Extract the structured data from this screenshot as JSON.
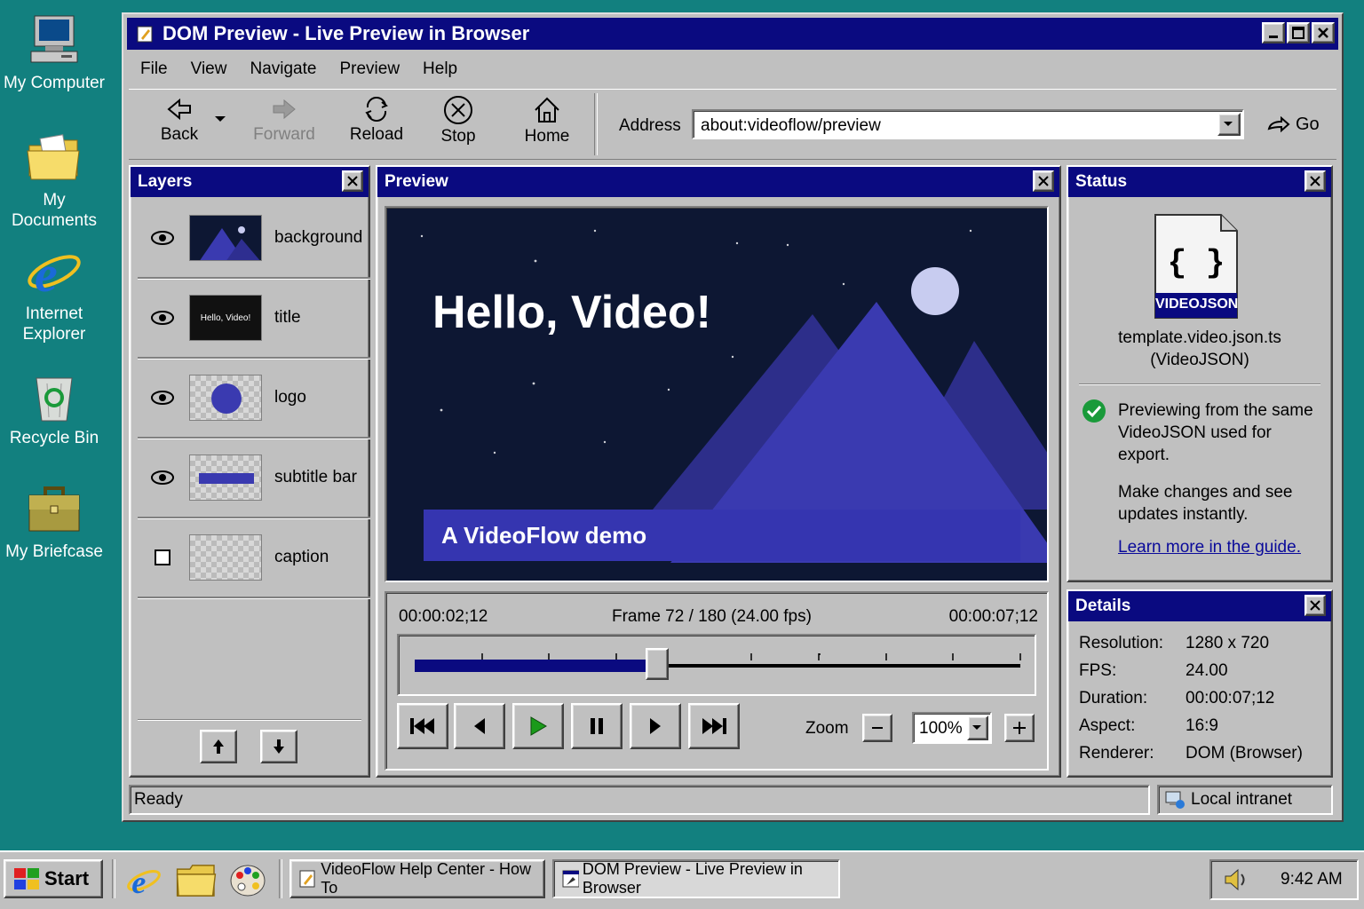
{
  "desktop": {
    "icons": [
      {
        "label": "My Computer",
        "icon": "computer-icon"
      },
      {
        "label": "My Documents",
        "icon": "folder-icon"
      },
      {
        "label": "Internet Explorer",
        "icon": "internet-explorer-icon"
      },
      {
        "label": "Recycle Bin",
        "icon": "recycle-bin-icon"
      },
      {
        "label": "My Briefcase",
        "icon": "briefcase-icon"
      }
    ]
  },
  "window": {
    "title": "DOM Preview - Live Preview in Browser",
    "menu": [
      "File",
      "View",
      "Navigate",
      "Preview",
      "Help"
    ],
    "toolbar": {
      "back": "Back",
      "forward": "Forward",
      "reload": "Reload",
      "stop": "Stop",
      "home": "Home"
    },
    "address": {
      "label": "Address",
      "value": "about:videoflow/preview",
      "go": "Go"
    }
  },
  "layers": {
    "title": "Layers",
    "items": [
      {
        "name": "background",
        "visible": true
      },
      {
        "name": "title",
        "visible": true,
        "thumb_text": "Hello, Video!"
      },
      {
        "name": "logo",
        "visible": true
      },
      {
        "name": "subtitle bar",
        "visible": true
      },
      {
        "name": "caption",
        "visible": false
      }
    ]
  },
  "preview": {
    "title": "Preview",
    "headline": "Hello, Video!",
    "subtitle": "A VideoFlow demo",
    "time_current": "00:00:02;12",
    "frame_info": "Frame 72 / 180 (24.00 fps)",
    "time_total": "00:00:07;12",
    "progress": 0.4,
    "zoom_label": "Zoom",
    "zoom_value": "100%"
  },
  "status": {
    "title": "Status",
    "file_badge": "VIDEOJSON",
    "file_name": "template.video.json.ts",
    "file_type": "(VideoJSON)",
    "message1": "Previewing from the same VideoJSON used for export.",
    "message2": "Make changes and see updates instantly.",
    "link": "Learn more in the guide."
  },
  "details": {
    "title": "Details",
    "rows": [
      {
        "k": "Resolution:",
        "v": "1280 x 720"
      },
      {
        "k": "FPS:",
        "v": "24.00"
      },
      {
        "k": "Duration:",
        "v": "00:00:07;12"
      },
      {
        "k": "Aspect:",
        "v": "16:9"
      },
      {
        "k": "Renderer:",
        "v": "DOM (Browser)"
      }
    ]
  },
  "statusbar": {
    "left": "Ready",
    "zone": "Local intranet"
  },
  "taskbar": {
    "start": "Start",
    "tasks": [
      "VideoFlow Help Center - How To",
      "DOM Preview - Live Preview in Browser"
    ],
    "clock": "9:42 AM"
  },
  "colors": {
    "desktop": "#12807f",
    "titlebar": "#0a0a80",
    "preview_bg": "#0d1733",
    "mountain": "#3a3ab0",
    "accent_link": "#0a0a9a"
  }
}
